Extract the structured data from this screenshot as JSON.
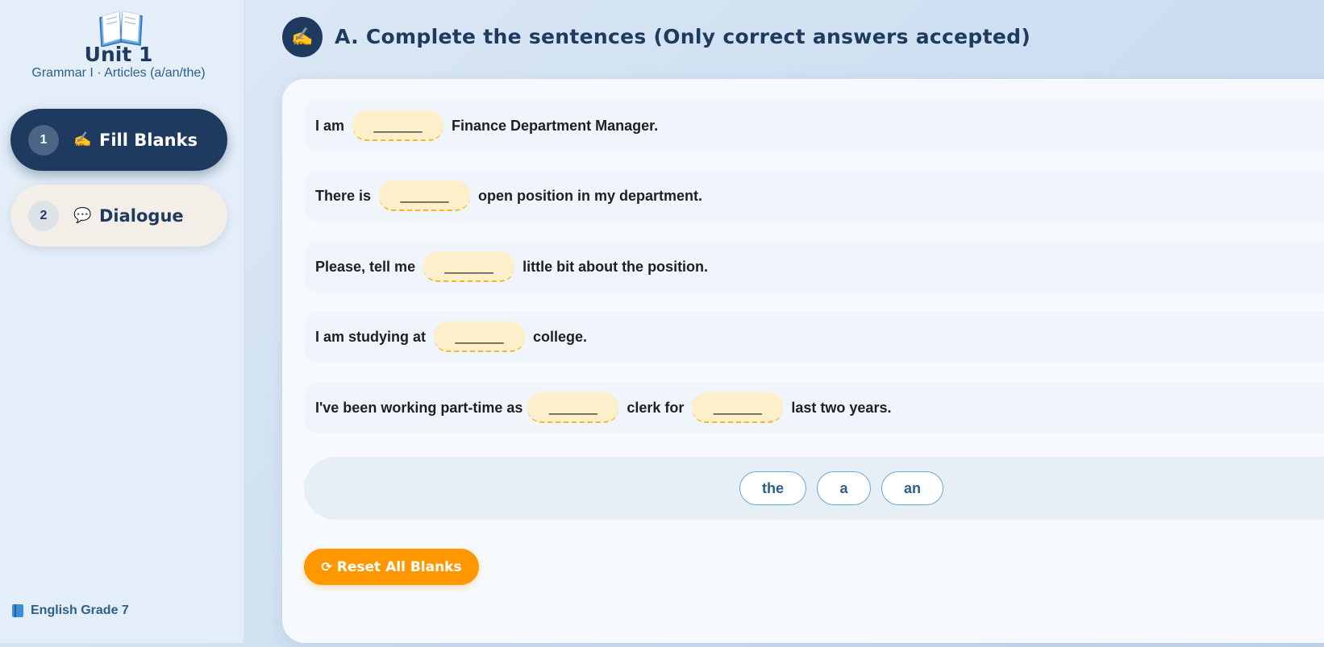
{
  "sidebar": {
    "icon": "open-book-icon",
    "unit_title": "Unit 1",
    "unit_subtitle": "Grammar I · Articles (a/an/the)",
    "items": [
      {
        "number": "1",
        "emoji": "✍️",
        "label": "Fill Blanks",
        "active": true
      },
      {
        "number": "2",
        "emoji": "💬",
        "label": "Dialogue",
        "active": false
      }
    ],
    "footer": "English Grade 7"
  },
  "header": {
    "emoji": "✍️",
    "title": "A. Complete the sentences (Only correct answers accepted)"
  },
  "sentences": [
    {
      "before": "I am",
      "after": "Finance Department Manager."
    },
    {
      "before": "There is",
      "after": "open position in my department."
    },
    {
      "before": "Please, tell me",
      "after": "little bit about the position."
    },
    {
      "before": "I am studying at",
      "after": "college."
    },
    {
      "before": "I've been working part-time as",
      "middle": "clerk for",
      "after": "last two years."
    }
  ],
  "blank_placeholder": "______",
  "word_bank": [
    "the",
    "a",
    "an"
  ],
  "reset_button": {
    "icon": "⟳",
    "label": "Reset All Blanks"
  },
  "colors": {
    "primary": "#1e3a5f",
    "accent": "#ff9800",
    "blank_fill": "#fdefc9",
    "blank_border": "#f2b829"
  }
}
